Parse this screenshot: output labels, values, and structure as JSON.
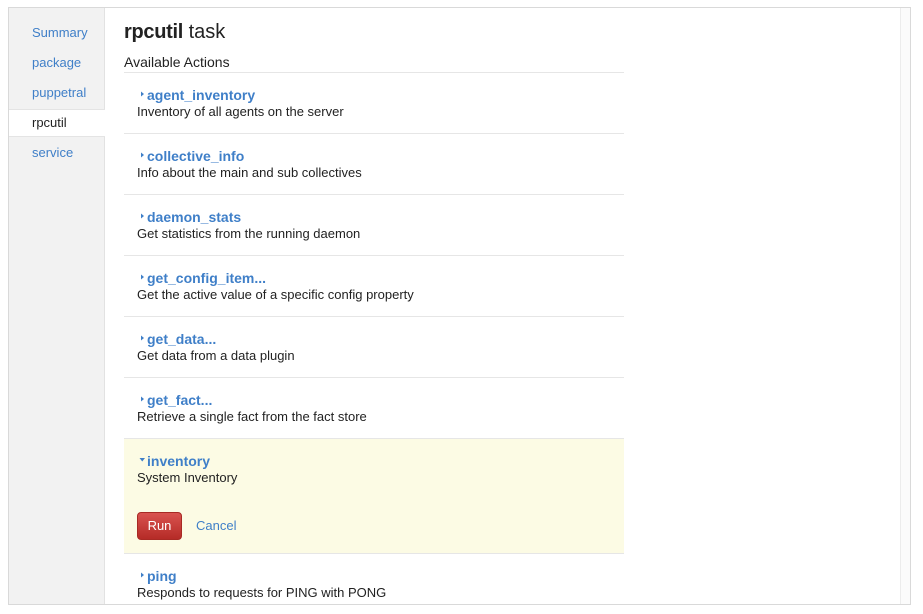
{
  "sidebar": {
    "items": [
      {
        "label": "Summary"
      },
      {
        "label": "package"
      },
      {
        "label": "puppetral"
      },
      {
        "label": "rpcutil"
      },
      {
        "label": "service"
      }
    ],
    "active": "rpcutil"
  },
  "header": {
    "agent_name": "rpcutil",
    "suffix": "task"
  },
  "section_label": "Available Actions",
  "actions": [
    {
      "name": "agent_inventory",
      "description": "Inventory of all agents on the server",
      "expanded": false
    },
    {
      "name": "collective_info",
      "description": "Info about the main and sub collectives",
      "expanded": false
    },
    {
      "name": "daemon_stats",
      "description": "Get statistics from the running daemon",
      "expanded": false
    },
    {
      "name": "get_config_item...",
      "description": "Get the active value of a specific config property",
      "expanded": false
    },
    {
      "name": "get_data...",
      "description": "Get data from a data plugin",
      "expanded": false
    },
    {
      "name": "get_fact...",
      "description": "Retrieve a single fact from the fact store",
      "expanded": false
    },
    {
      "name": "inventory",
      "description": "System Inventory",
      "expanded": true
    },
    {
      "name": "ping",
      "description": "Responds to requests for PING with PONG",
      "expanded": false
    }
  ],
  "expanded_controls": {
    "run_label": "Run",
    "cancel_label": "Cancel"
  },
  "colors": {
    "link": "#3f7fc8",
    "expanded_background": "#fcfbe4",
    "run_button": "#c9302c",
    "sidebar_background": "#f2f2f2"
  },
  "icons": {
    "collapsed": "caret-right-icon",
    "expanded": "caret-down-icon"
  }
}
